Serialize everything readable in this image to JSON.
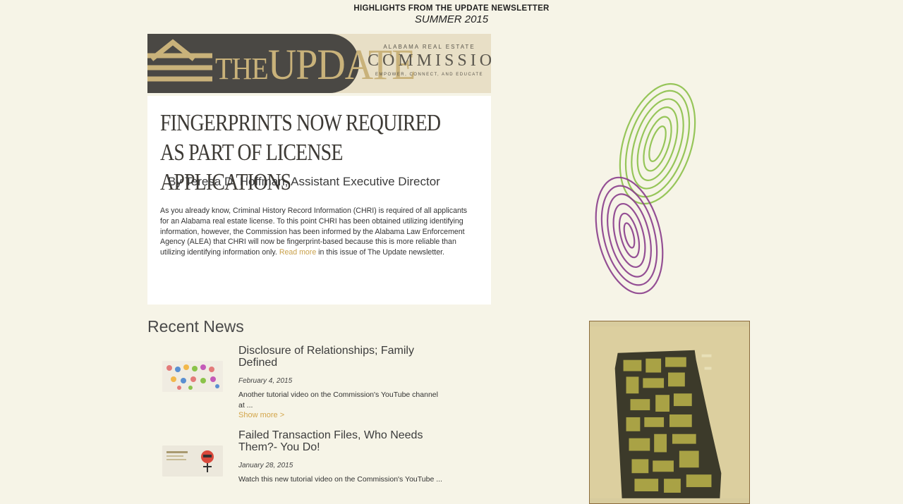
{
  "header": {
    "line1": "HIGHLIGHTS FROM THE UPDATE NEWSLETTER",
    "line2": "SUMMER 2015"
  },
  "banner": {
    "title_prefix": "THE",
    "title_main": "UPDATE",
    "org_top": "ALABAMA REAL ESTATE",
    "org_main": "COMMISSION",
    "org_tagline": "EMPOWER, CONNECT, AND EDUCATE",
    "colors": {
      "dark": "#4a4844",
      "gold": "#c9b27a",
      "cream": "#e8dfc6"
    }
  },
  "article": {
    "headline": "Fingerprints Now Required as Part of License Applications",
    "byline": "By Teresa D. Hoffman, Assistant Executive Director",
    "body_text": "As you already know, Criminal History Record Information (CHRI) is required of all applicants for an Alabama real estate license. To this point CHRI has been obtained utilizing identifying information, however, the Commission has been informed by the Alabama Law Enforcement Agency (ALEA) that CHRI will now be fingerprint-based because this is more reliable than utilizing identifying information only.",
    "read_more": "Read more",
    "body_tail": "in this issue of The Update newsletter."
  },
  "recent_news": {
    "title": "Recent News",
    "items": [
      {
        "title": "Disclosure of Relationships; Family Defined",
        "date": "February 4, 2015",
        "excerpt": "Another tutorial video on the Commission's YouTube channel at ...",
        "more": "Show more >"
      },
      {
        "title": "Failed Transaction Files, Who Needs Them?- You Do!",
        "date": "January 28, 2015",
        "excerpt": "Watch this new tutorial video on the Commission's YouTube ..."
      }
    ]
  },
  "accent_colors": {
    "link": "#c9a04a",
    "fingerprint_green": "#8cc14a",
    "fingerprint_purple": "#8a3e8c"
  }
}
